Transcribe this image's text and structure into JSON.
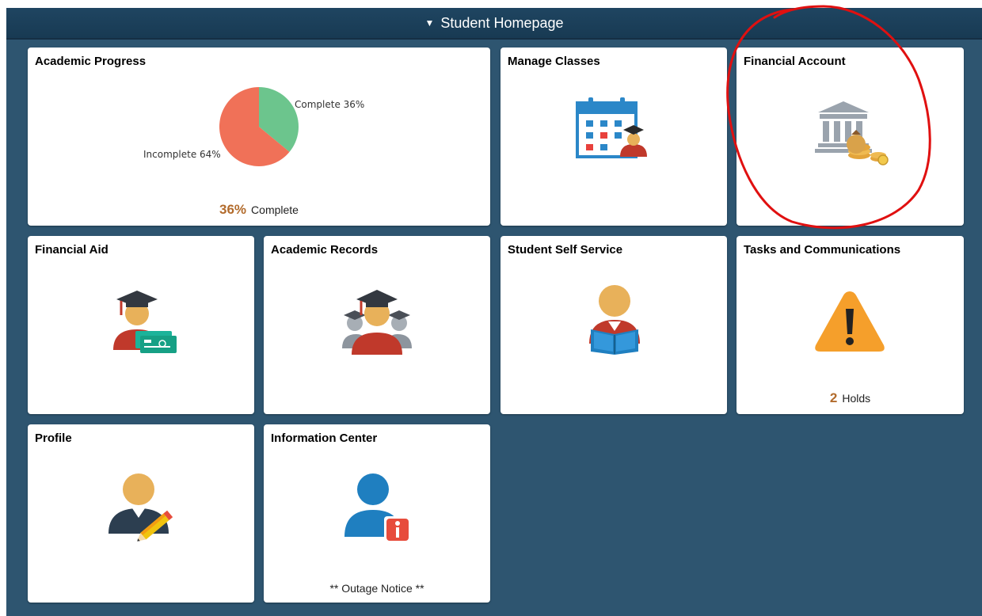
{
  "header": {
    "toggle_glyph": "▼",
    "title": "Student Homepage"
  },
  "tiles": {
    "academic_progress": {
      "title": "Academic Progress",
      "footer_value": "36%",
      "footer_label": "Complete",
      "chart_data": {
        "type": "pie",
        "slices": [
          {
            "label": "Complete 36%",
            "value": 36,
            "color": "#6cc58d"
          },
          {
            "label": "Incomplete 64%",
            "value": 64,
            "color": "#f07158"
          }
        ]
      }
    },
    "manage_classes": {
      "title": "Manage Classes",
      "icon": "calendar-student-icon"
    },
    "financial_account": {
      "title": "Financial Account",
      "icon": "bank-coins-icon"
    },
    "financial_aid": {
      "title": "Financial Aid",
      "icon": "graduate-money-icon"
    },
    "academic_records": {
      "title": "Academic Records",
      "icon": "graduates-group-icon"
    },
    "student_self_service": {
      "title": "Student Self Service",
      "icon": "student-reading-icon"
    },
    "tasks_communications": {
      "title": "Tasks and Communications",
      "icon": "warning-icon",
      "footer_value": "2",
      "footer_label": "Holds"
    },
    "profile": {
      "title": "Profile",
      "icon": "user-edit-icon"
    },
    "information_center": {
      "title": "Information Center",
      "icon": "user-info-icon",
      "footer_label": "** Outage Notice **"
    }
  },
  "colors": {
    "background": "#2e5570",
    "header": "#1f4561",
    "accent_number": "#b26b2c",
    "annotation": "#e01010"
  }
}
